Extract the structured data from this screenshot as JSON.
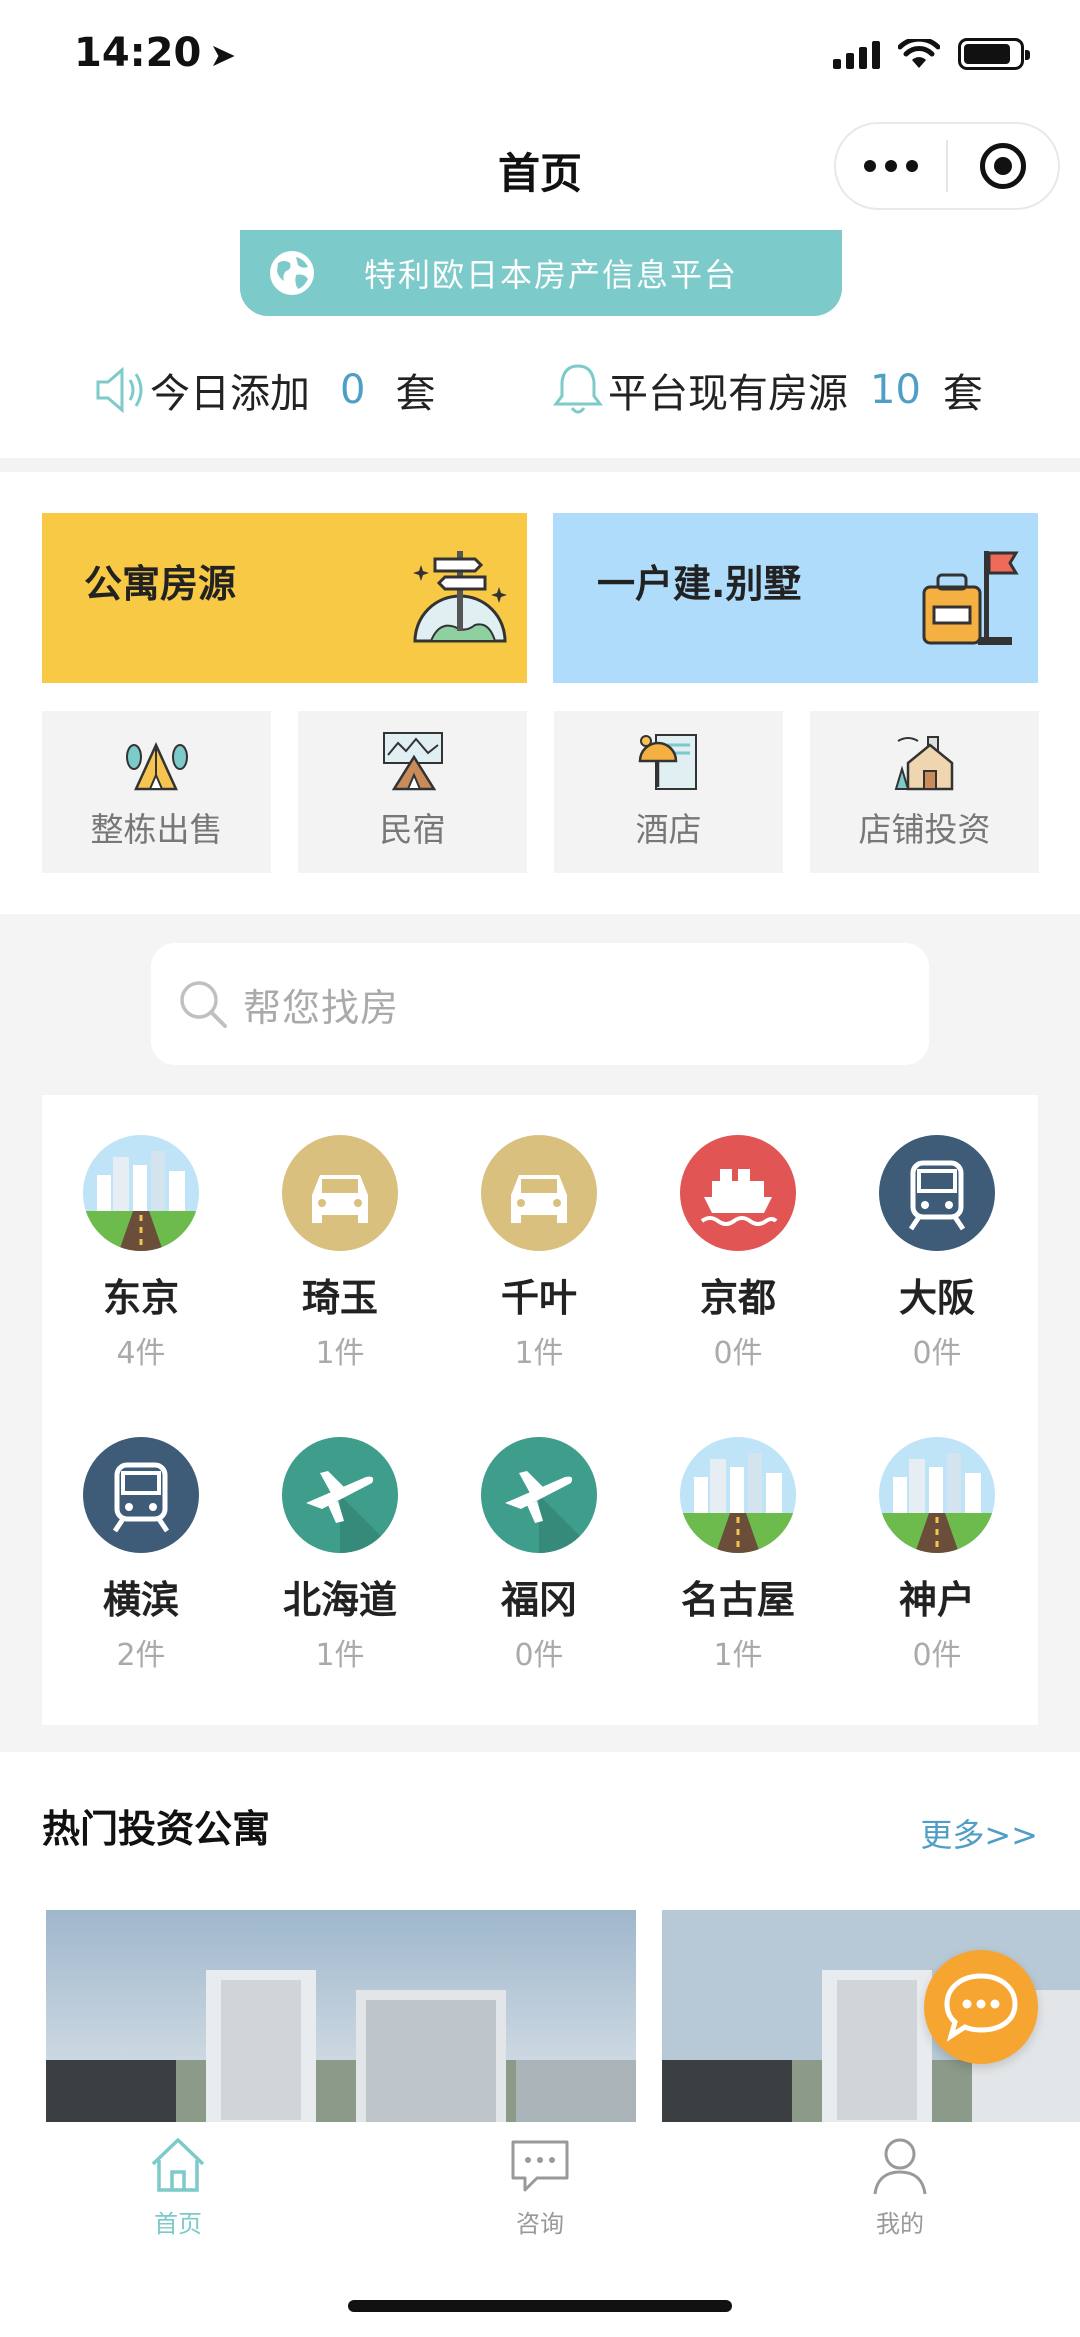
{
  "status_bar": {
    "time": "14:20"
  },
  "nav": {
    "title": "首页"
  },
  "banner": {
    "text": "特利欧日本房产信息平台",
    "icon": "globe-icon"
  },
  "stats": {
    "today_label": "今日添加",
    "today_count": "0",
    "today_unit": "套",
    "total_label": "平台现有房源",
    "total_count": "10",
    "total_unit": "套"
  },
  "categories": {
    "large": [
      {
        "label": "公寓房源",
        "color": "#f8c944",
        "icon": "signpost-globe-icon"
      },
      {
        "label": "一户建.别墅",
        "color": "#aedcfa",
        "icon": "flag-luggage-icon"
      }
    ],
    "small": [
      {
        "label": "整栋出售",
        "icon": "tent-trees-icon"
      },
      {
        "label": "民宿",
        "icon": "camping-tent-icon"
      },
      {
        "label": "酒店",
        "icon": "beach-umbrella-icon"
      },
      {
        "label": "店铺投资",
        "icon": "house-factory-icon"
      }
    ]
  },
  "search": {
    "placeholder": "帮您找房"
  },
  "cities": [
    {
      "name": "东京",
      "count": "4件",
      "icon": "city-road-icon"
    },
    {
      "name": "琦玉",
      "count": "1件",
      "icon": "car-icon"
    },
    {
      "name": "千叶",
      "count": "1件",
      "icon": "car-icon"
    },
    {
      "name": "京都",
      "count": "0件",
      "icon": "ship-icon"
    },
    {
      "name": "大阪",
      "count": "0件",
      "icon": "train-icon"
    },
    {
      "name": "横滨",
      "count": "2件",
      "icon": "train-icon"
    },
    {
      "name": "北海道",
      "count": "1件",
      "icon": "airplane-icon"
    },
    {
      "name": "福冈",
      "count": "0件",
      "icon": "airplane-icon"
    },
    {
      "name": "名古屋",
      "count": "1件",
      "icon": "city-road-icon"
    },
    {
      "name": "神户",
      "count": "0件",
      "icon": "city-road-icon"
    }
  ],
  "hot": {
    "title": "热门投资公寓",
    "more": "更多>>"
  },
  "tabs": [
    {
      "label": "首页",
      "icon": "home-icon",
      "active": true
    },
    {
      "label": "咨询",
      "icon": "chat-icon",
      "active": false
    },
    {
      "label": "我的",
      "icon": "user-icon",
      "active": false
    }
  ],
  "colors": {
    "accent": "#7ccac9",
    "link": "#4e9ec6",
    "fab": "#f7a531"
  }
}
